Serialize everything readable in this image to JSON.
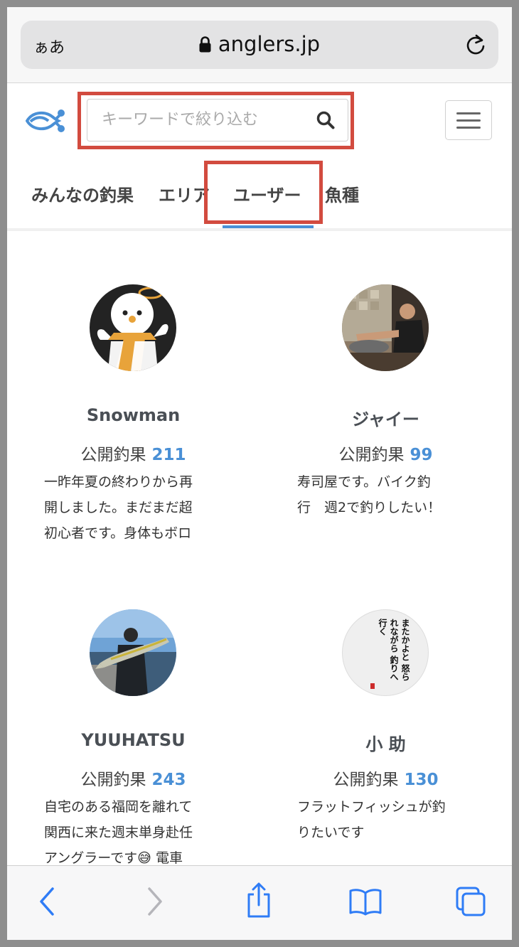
{
  "browser": {
    "text_size_label": "ぁあ",
    "url": "anglers.jp"
  },
  "header": {
    "search_placeholder": "キーワードで絞り込む"
  },
  "tabs": [
    {
      "label": "みんなの釣果"
    },
    {
      "label": "エリア"
    },
    {
      "label": "ユーザー"
    },
    {
      "label": "魚種"
    }
  ],
  "users": [
    {
      "name": "Snowman",
      "count_label": "公開釣果",
      "count": "211",
      "bio_lines": [
        "一昨年夏の終わりから再",
        "開しました。まだまだ超",
        "初心者です。身体もボロ"
      ]
    },
    {
      "name": "ジャイー",
      "count_label": "公開釣果",
      "count": "99",
      "bio_lines": [
        "寿司屋です。バイク釣",
        "行　週2で釣りしたい！"
      ]
    },
    {
      "name": "YUUHATSU",
      "count_label": "公開釣果",
      "count": "243",
      "bio_lines": [
        "自宅のある福岡を離れて",
        "関西に来た週末単身赴任",
        "アングラーです😅 電車"
      ]
    },
    {
      "name": "小 助",
      "count_label": "公開釣果",
      "count": "130",
      "bio_lines": [
        "フラットフィッシュが釣",
        "りたいです"
      ],
      "avatar_text": [
        "またかよと",
        "怒られながら",
        "釣りへ行く"
      ]
    }
  ],
  "colors": {
    "accent": "#4a90d6",
    "highlight": "#d24b3f"
  }
}
